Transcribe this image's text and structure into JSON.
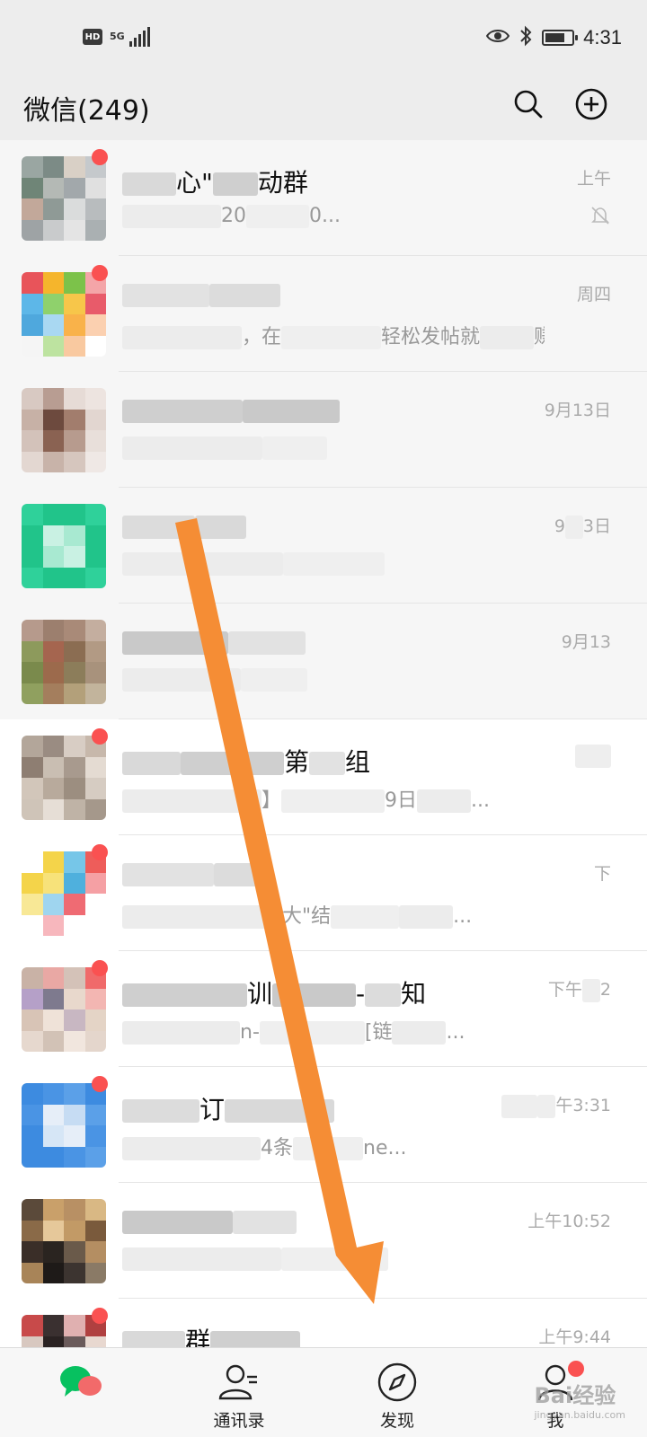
{
  "status_bar": {
    "hd_badge": "HD",
    "network": "5G",
    "time": "4:31",
    "battery_level": 0.75,
    "icons": [
      "eye-icon",
      "bluetooth-icon",
      "battery-icon"
    ]
  },
  "header": {
    "title": "微信(249)",
    "icons": [
      "search-icon",
      "add-icon"
    ]
  },
  "chats": [
    {
      "name": "心\"",
      "name2": "动群",
      "preview": "20",
      "preview2": "0...",
      "time": "上午",
      "muted": true,
      "badge": true,
      "pinned": true,
      "colors": [
        "#9aa6a2",
        "#7c8b86",
        "#d9d0c6",
        "#c5c9cc",
        "#6f8577",
        "#b4b9b5",
        "#a2a8ab",
        "#e0e0e0",
        "#c2a89a",
        "#8f9a96",
        "#dadcdc",
        "#b8bcbe",
        "#9ea3a5",
        "#c9cbcc",
        "#e4e4e4",
        "#aab0b2"
      ]
    },
    {
      "name": "",
      "name2": "",
      "preview": "，在",
      "preview2": "轻松发帖就",
      "preview3": "赚...",
      "time": "周四",
      "muted": false,
      "badge": true,
      "pinned": true,
      "colors": [
        "#e8545a",
        "#f5b52c",
        "#7cc24a",
        "#f4a5a8",
        "#5db7e8",
        "#8fd16c",
        "#f7c64a",
        "#e85b6a",
        "#4fa8dd",
        "#a9d8f2",
        "#f9b24a",
        "#fbd0b0",
        "#f5f5f5",
        "#bde3a0",
        "#f9c9a0",
        "#ffffff"
      ]
    },
    {
      "name": "",
      "name2": "",
      "preview": "",
      "preview2": "",
      "time": "9月13日",
      "muted": false,
      "badge": false,
      "pinned": true,
      "colors": [
        "#d8c9c2",
        "#b89d92",
        "#e6dbd6",
        "#ede4e0",
        "#c7b1a6",
        "#6d4a3e",
        "#a27d6d",
        "#e2d6d0",
        "#d3c2ba",
        "#8a6252",
        "#b79b8e",
        "#e8dfda",
        "#e3d7d1",
        "#c8b3a9",
        "#d6c6be",
        "#efe8e5"
      ]
    },
    {
      "name": "",
      "name2": "",
      "preview": "",
      "preview2": "",
      "time": "9",
      "time2": "3日",
      "muted": false,
      "badge": false,
      "pinned": true,
      "colors": [
        "#2fd19a",
        "#21c48a",
        "#21c48a",
        "#2fd19a",
        "#21c48a",
        "#c9f1e3",
        "#a8e9d1",
        "#21c48a",
        "#21c48a",
        "#a8e9d1",
        "#c9f1e3",
        "#21c48a",
        "#2fd19a",
        "#21c48a",
        "#21c48a",
        "#2fd19a"
      ]
    },
    {
      "name": "",
      "name2": "",
      "preview": "",
      "preview2": "",
      "time": "9月13",
      "muted": false,
      "badge": false,
      "pinned": true,
      "colors": [
        "#b69a8c",
        "#9c7f6e",
        "#a98a78",
        "#c4ae9f",
        "#8d9a5c",
        "#a5654f",
        "#8b6d52",
        "#b29a84",
        "#7a8a4c",
        "#9c6a4c",
        "#8c7d5a",
        "#a8927c",
        "#90a05f",
        "#a47e5d",
        "#b3a07a",
        "#c2b49c"
      ]
    },
    {
      "name": "",
      "name2": "第",
      "name3": "组",
      "preview": "】",
      "preview2": "9日",
      "preview3": "...",
      "time": "",
      "muted": false,
      "badge": true,
      "pinned": false,
      "colors": [
        "#b3a69a",
        "#9a8c82",
        "#d8cdc4",
        "#c7b8ab",
        "#8e7e72",
        "#c9beb2",
        "#a89a8e",
        "#e4dbd2",
        "#d2c6ba",
        "#b8aa9c",
        "#9c8e80",
        "#d6ccc2",
        "#cfc4b8",
        "#e6ded6",
        "#bfb3a6",
        "#a5988b"
      ]
    },
    {
      "name": "",
      "name2": "",
      "preview": "大\"结",
      "preview2": "",
      "preview3": "...",
      "time": "下",
      "muted": false,
      "badge": true,
      "pinned": false,
      "colors": [
        "#ffffff",
        "#f4d44a",
        "#76c6e8",
        "#ee5d5a",
        "#f4d44a",
        "#f7e27a",
        "#4fb0dd",
        "#f5a0a4",
        "#f8e896",
        "#9fd5ef",
        "#ef6b73",
        "#ffffff",
        "#ffffff",
        "#f7b7bd",
        "#ffffff",
        "#ffffff"
      ]
    },
    {
      "name": "训",
      "name2": "-",
      "name3": "知",
      "preview": "n-",
      "preview2": "[链",
      "preview3": "...",
      "time": "下午",
      "time2": "2",
      "muted": false,
      "badge": true,
      "pinned": false,
      "colors": [
        "#c9b2a6",
        "#e9a8a4",
        "#d4c2b8",
        "#f06a6a",
        "#b5a0c8",
        "#7e7a8e",
        "#e8d8cc",
        "#f3b6b2",
        "#d8c4b6",
        "#efe2d8",
        "#c8b7c2",
        "#e4d4c6",
        "#e6d8ce",
        "#d2c2b6",
        "#f1e6de",
        "#e4d6cc"
      ]
    },
    {
      "name": "订",
      "name2": "",
      "preview": "4条",
      "preview2": "ne...",
      "time": "",
      "time2": "午3:31",
      "muted": false,
      "badge": true,
      "pinned": false,
      "colors": [
        "#3d8be0",
        "#4a94e4",
        "#5ba0e8",
        "#3d8be0",
        "#4a94e4",
        "#e6eef8",
        "#c6dcf3",
        "#5ba0e8",
        "#3d8be0",
        "#d6e6f6",
        "#e6eef8",
        "#4a94e4",
        "#3d8be0",
        "#3d8be0",
        "#4a94e4",
        "#5ba0e8"
      ]
    },
    {
      "name": "",
      "name2": "",
      "preview": "",
      "preview2": "",
      "time": "上午10:52",
      "muted": false,
      "badge": false,
      "pinned": false,
      "colors": [
        "#5b4a3a",
        "#c9a06a",
        "#b89064",
        "#d9b884",
        "#8a6a48",
        "#e6c89a",
        "#c29a66",
        "#7a5a3c",
        "#3a2e28",
        "#2a2420",
        "#6a5a4a",
        "#b48e62",
        "#a88458",
        "#1e1a18",
        "#3c3430",
        "#8a7a66"
      ]
    },
    {
      "name": "群",
      "name2": "",
      "preview": "",
      "preview2": "",
      "time": "上午9:44",
      "muted": false,
      "badge": true,
      "pinned": false,
      "colors": [
        "#c84a4a",
        "#3a3030",
        "#e0b0b0",
        "#b04040",
        "#d8c8c0",
        "#2a2222",
        "#6a5a5a",
        "#e8d8d0",
        "#b89a8a",
        "#d8c0b8",
        "#f0e0d8",
        "#c8b0a8",
        "#e8d0c8",
        "#f0e8e0",
        "#d8c8c0",
        "#e0d0c8"
      ]
    }
  ],
  "tabbar": {
    "tabs": [
      {
        "label": "",
        "active": true,
        "icon": "chat-icon",
        "dot": false
      },
      {
        "label": "通讯录",
        "active": false,
        "icon": "contacts-icon",
        "dot": false
      },
      {
        "label": "发现",
        "active": false,
        "icon": "discover-icon",
        "dot": false
      },
      {
        "label": "我",
        "active": false,
        "icon": "me-icon",
        "dot": true
      }
    ]
  },
  "annotation": {
    "color": "#f58d35",
    "icon": "arrow-annotation"
  },
  "watermark": {
    "brand": "Bai",
    "brand2": "经验",
    "url": "jingyan.baidu.com"
  }
}
